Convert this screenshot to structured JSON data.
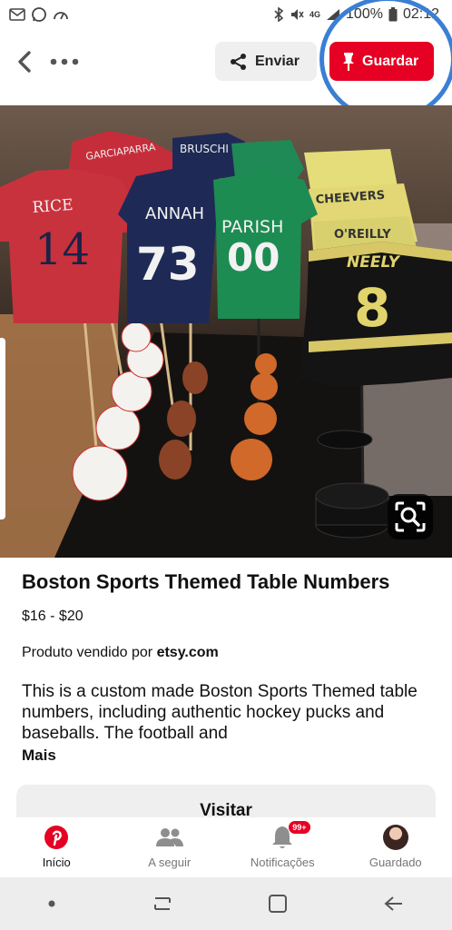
{
  "status_bar": {
    "battery": "100%",
    "time": "02:12",
    "network": "4G"
  },
  "toolbar": {
    "send_label": "Enviar",
    "save_label": "Guardar"
  },
  "image": {
    "jerseys": [
      {
        "name": "RICE",
        "number": "14"
      },
      {
        "name": "ANNAH",
        "number": "73"
      },
      {
        "name": "PARISH",
        "number": "00"
      },
      {
        "name": "NEELY",
        "number": "8"
      },
      {
        "name": "GARCIAPARRA",
        "number": ""
      },
      {
        "name": "BRUSCHI",
        "number": ""
      },
      {
        "name": "CHEEVERS",
        "number": ""
      },
      {
        "name": "O'REILLY",
        "number": ""
      }
    ]
  },
  "pin": {
    "title": "Boston Sports Themed Table Numbers",
    "price": "$16 - $20",
    "seller_prefix": "Produto vendido por",
    "seller_name": "etsy.com",
    "description": "This is a custom made Boston Sports Themed table numbers, including authentic hockey pucks and baseballs.  The football and",
    "more_label": "Mais",
    "visit_label": "Visitar"
  },
  "bottom_nav": {
    "home": "Início",
    "following": "A seguir",
    "notifications": "Notificações",
    "notifications_badge": "99+",
    "saved": "Guardado"
  },
  "colors": {
    "brand_red": "#e60023",
    "annotation_ring": "#3b7fd4"
  }
}
